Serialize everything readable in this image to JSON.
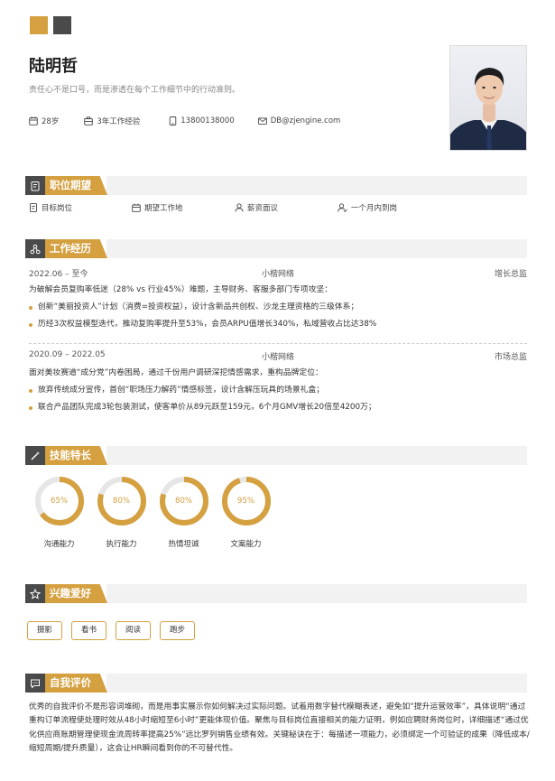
{
  "colors": {
    "accent": "#d4a040",
    "dark": "#4a4a4a",
    "band": "#f2f2f2"
  },
  "header": {
    "name": "陆明哲",
    "motto": "责任心不是口号，而是渗透在每个工作细节中的行动准则。",
    "info": [
      {
        "icon": "calendar-icon",
        "text": "28岁"
      },
      {
        "icon": "briefcase-icon",
        "text": "3年工作经验"
      },
      {
        "icon": "phone-icon",
        "text": "13800138000"
      },
      {
        "icon": "mail-icon",
        "text": "DB@zjengine.com"
      }
    ]
  },
  "sections": {
    "expectation": "职位期望",
    "experience": "工作经历",
    "skills": "技能特长",
    "hobbies": "兴趣爱好",
    "self_eval": "自我评价"
  },
  "expectation": [
    {
      "icon": "document-icon",
      "text": "目标岗位"
    },
    {
      "icon": "building-icon",
      "text": "期望工作地"
    },
    {
      "icon": "person-icon",
      "text": "薪资面议"
    },
    {
      "icon": "person-check-icon",
      "text": "一个月内到岗"
    }
  ],
  "jobs": [
    {
      "date": "2022.06 – 至今",
      "company": "小楷网络",
      "role": "增长总监",
      "desc": "为破解会员复购率低迷（28% vs 行业45%）难题，主导财务、客服多部门专项攻坚：",
      "bullets": [
        "创新“美丽投资人”计划（消费=投资权益），设计含新品共创权、沙龙主理资格的三级体系；",
        "历经3次权益模型迭代，推动复购率提升至53%，会员ARPU值增长340%，私域营收占比达38%"
      ]
    },
    {
      "date": "2020.09 – 2022.05",
      "company": "小楷网络",
      "role": "市场总监",
      "desc": "面对美妆赛道“成分党”内卷困局，通过千份用户调研深挖情感需求，重构品牌定位：",
      "bullets": [
        "放弃传统成分宣传，首创“职场压力解药”情感标签，设计含解压玩具的场景礼盒；",
        "联合产品团队完成3轮包装测试，使客单价从89元跃至159元，6个月GMV增长20倍至4200万；"
      ]
    }
  ],
  "skills": [
    {
      "label": "沟通能力",
      "value": 65,
      "text": "65%"
    },
    {
      "label": "执行能力",
      "value": 80,
      "text": "80%"
    },
    {
      "label": "热情坦诚",
      "value": 80,
      "text": "80%"
    },
    {
      "label": "文案能力",
      "value": 95,
      "text": "95%"
    }
  ],
  "hobbies": [
    "摄影",
    "看书",
    "阅读",
    "跑步"
  ],
  "self_eval": "优秀的自我评价不是形容词堆砌，而是用事实展示你如何解决过实际问题。试着用数字替代模糊表述，避免如“提升运营效率”，具体说明“通过重构订单流程使处理时效从48小时缩短至6小时”更能体现价值。聚焦与目标岗位直接相关的能力证明，例如应聘财务岗位时，详细描述“通过优化供应商账期管理使现金流周转率提高25%”远比罗列销售业绩有效。关键秘诀在于：每描述一项能力，必须绑定一个可验证的成果（降低成本/缩短周期/提升质量），这会让HR瞬间看到你的不可替代性。"
}
